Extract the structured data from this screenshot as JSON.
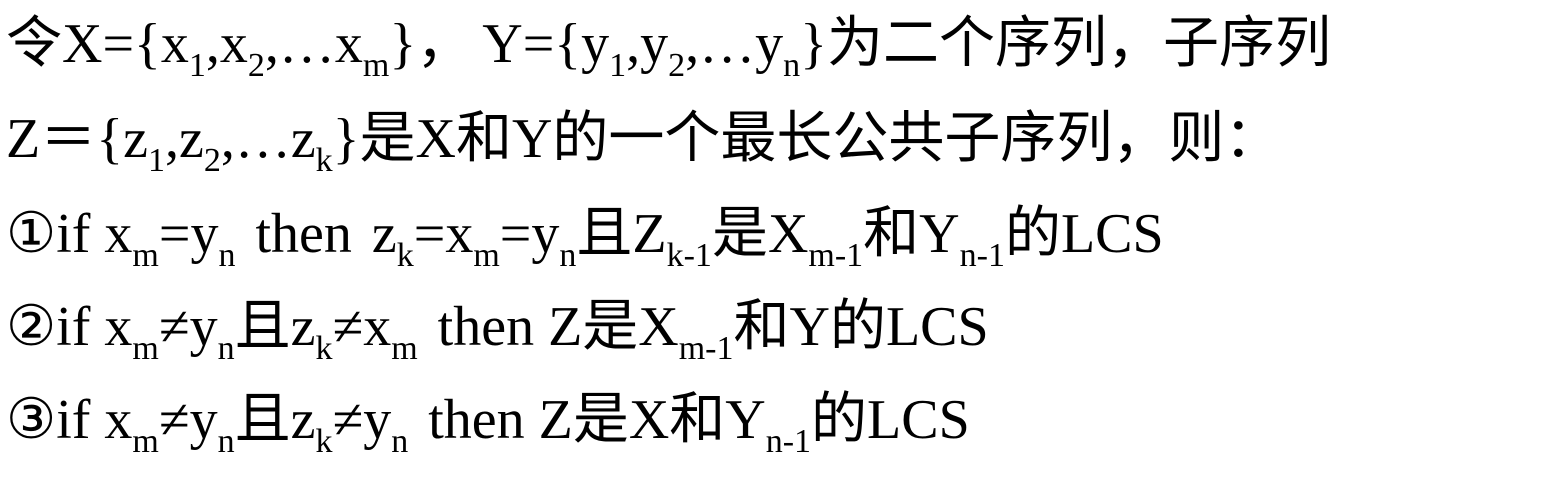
{
  "document": {
    "line1": {
      "t1": "令X={x",
      "s1": "1",
      "t2": ",x",
      "s2": "2",
      "t3": ",…x",
      "s3": "m",
      "t4": "}，",
      "t5": "Y={y",
      "s5": "1",
      "t6": ",y",
      "s6": "2",
      "t7": ",…y",
      "s7": "n",
      "t8": "}为二个序列，子序列"
    },
    "line2": {
      "t1": "Z＝{z",
      "s1": "1",
      "t2": ",z",
      "s2": "2",
      "t3": ",…z",
      "s3": "k",
      "t4": "}是X和Y的一个最长公共子序列，则："
    },
    "line3": {
      "t1": "①if x",
      "s1": "m",
      "t2": "=y",
      "s2": "n",
      "t3": "then",
      "t4": "z",
      "s4": "k",
      "t5": "=x",
      "s5": "m",
      "t6": "=y",
      "s6": "n",
      "t7": "且Z",
      "s7": "k-1",
      "t8": "是X",
      "s8": "m-1",
      "t9": "和Y",
      "s9": "n-1",
      "t10": "的LCS"
    },
    "line4": {
      "t1": "②if x",
      "s1": "m",
      "t2": "≠y",
      "s2": "n",
      "t3": "且z",
      "s3": "k",
      "t4": "≠x",
      "s4": "m",
      "t5": "then Z是X",
      "s5": "m-1",
      "t6": "和Y的LCS"
    },
    "line5": {
      "t1": "③if x",
      "s1": "m",
      "t2": "≠y",
      "s2": "n",
      "t3": "且z",
      "s3": "k",
      "t4": "≠y",
      "s4": "n",
      "t5": "then Z是X和Y",
      "s5": "n-1",
      "t6": "的LCS"
    }
  }
}
